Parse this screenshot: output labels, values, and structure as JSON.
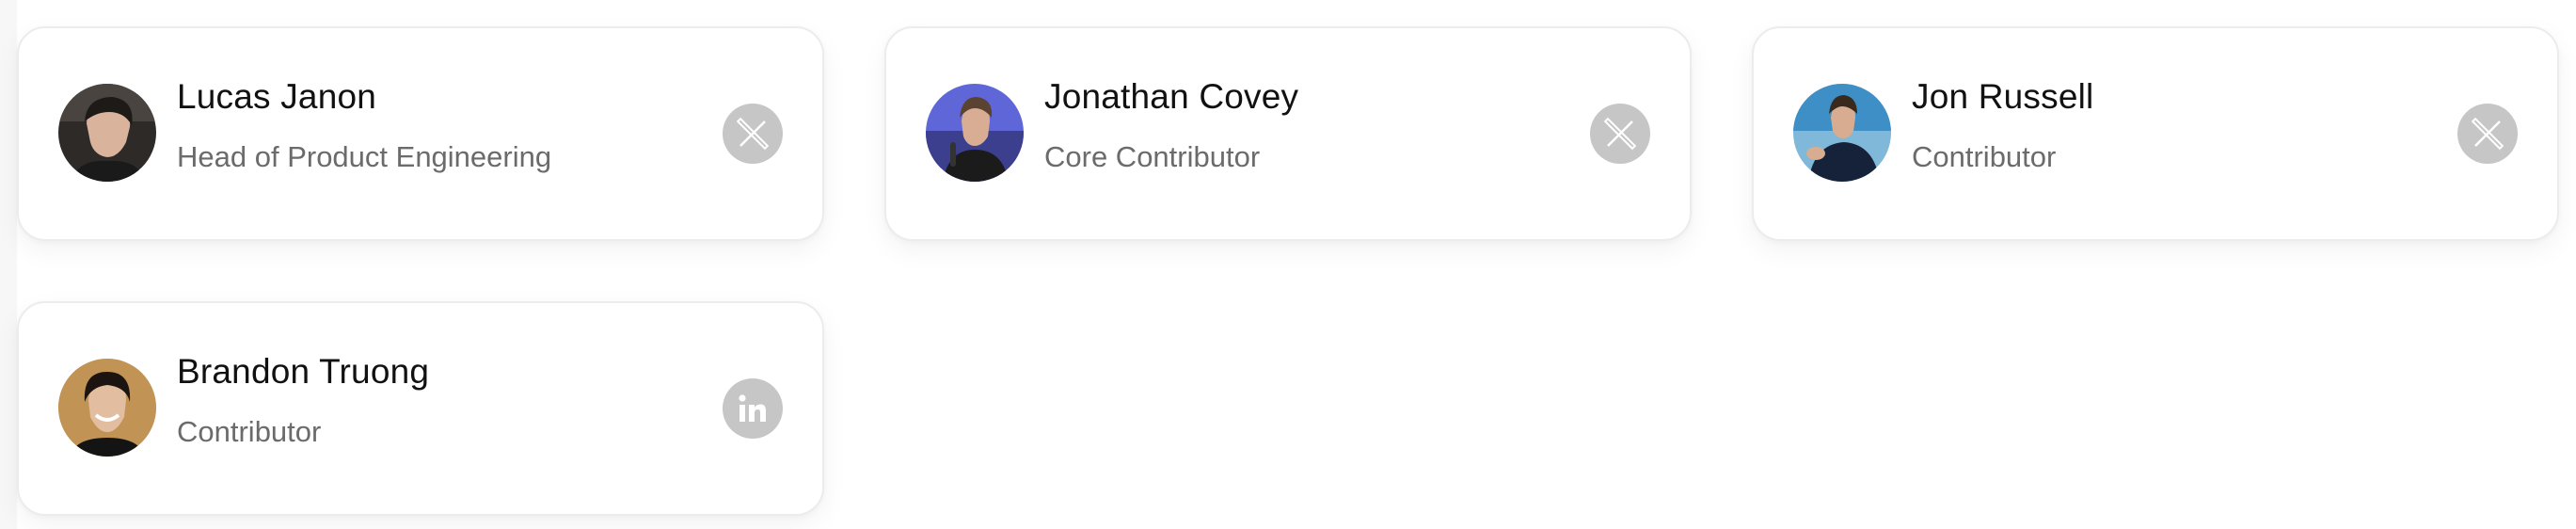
{
  "people": [
    {
      "name": "Lucas Janon",
      "role": "Head of Product Engineering",
      "social_icon": "x-icon",
      "avatar_bg": "#2d2a27"
    },
    {
      "name": "Jonathan Covey",
      "role": "Core Contributor",
      "social_icon": "x-icon",
      "avatar_bg": "#5f67d8"
    },
    {
      "name": "Jon Russell",
      "role": "Contributor",
      "social_icon": "x-icon",
      "avatar_bg": "#3f8fc7"
    },
    {
      "name": "Brandon Truong",
      "role": "Contributor",
      "social_icon": "linkedin-icon",
      "avatar_bg": "#b9894c"
    }
  ],
  "colors": {
    "card_border": "#ececec",
    "name_text": "#111111",
    "role_text": "#6b6b6b",
    "social_bg": "#c6c6c6"
  }
}
